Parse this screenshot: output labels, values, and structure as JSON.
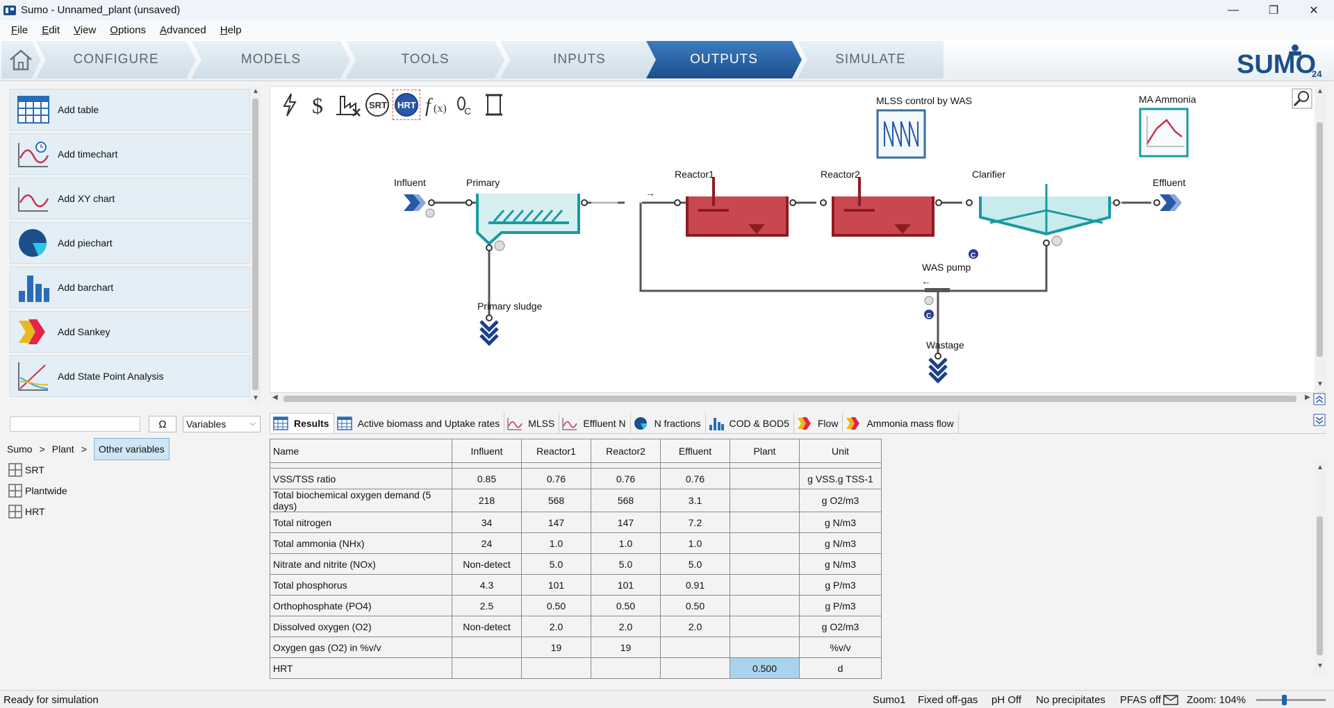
{
  "window": {
    "title": "Sumo - Unnamed_plant (unsaved)",
    "minimize": "—",
    "maximize": "❐",
    "close": "✕"
  },
  "menu": {
    "items": [
      {
        "pre": "",
        "ul": "F",
        "post": "ile"
      },
      {
        "pre": "",
        "ul": "E",
        "post": "dit"
      },
      {
        "pre": "",
        "ul": "V",
        "post": "iew"
      },
      {
        "pre": "",
        "ul": "O",
        "post": "ptions"
      },
      {
        "pre": "",
        "ul": "A",
        "post": "dvanced"
      },
      {
        "pre": "",
        "ul": "H",
        "post": "elp"
      }
    ]
  },
  "nav": {
    "tabs": [
      "CONFIGURE",
      "MODELS",
      "TOOLS",
      "INPUTS",
      "OUTPUTS",
      "SIMULATE"
    ],
    "active": "OUTPUTS",
    "logo_text": "SUMO",
    "logo_version": "24"
  },
  "tools": [
    "Add table",
    "Add timechart",
    "Add XY chart",
    "Add piechart",
    "Add barchart",
    "Add Sankey",
    "Add State Point Analysis"
  ],
  "variables": {
    "search_value": "",
    "omega": "Ω",
    "selector": "Variables",
    "breadcrumb": [
      "Sumo",
      ">",
      "Plant",
      ">"
    ],
    "breadcrumb_active": "Other variables",
    "items": [
      "SRT",
      "Plantwide",
      "HRT"
    ]
  },
  "diagram": {
    "toolbar": [
      "lightning-icon",
      "dollar-icon",
      "offgas-icon",
      "SRT",
      "HRT",
      "function-icon",
      "footprint-icon",
      "scroll-icon"
    ],
    "labels": {
      "influent": "Influent",
      "primary": "Primary",
      "reactor1": "Reactor1",
      "reactor2": "Reactor2",
      "clarifier": "Clarifier",
      "effluent": "Effluent",
      "primary_sludge": "Primary sludge",
      "was_pump": "WAS pump",
      "wastage": "Wastage",
      "mlss_control": "MLSS control by WAS",
      "ma_ammonia": "MA Ammonia",
      "controller_badge": "C"
    }
  },
  "output_tabs": [
    {
      "label": "Results",
      "icon": "table-icon",
      "active": true
    },
    {
      "label": "Active biomass and Uptake rates",
      "icon": "table-icon",
      "active": false
    },
    {
      "label": "MLSS",
      "icon": "timechart-icon",
      "active": false
    },
    {
      "label": "Effluent N",
      "icon": "timechart-icon",
      "active": false
    },
    {
      "label": "N fractions",
      "icon": "piechart-icon",
      "active": false
    },
    {
      "label": "COD & BOD5",
      "icon": "barchart-icon",
      "active": false
    },
    {
      "label": "Flow",
      "icon": "sankey-icon",
      "active": false
    },
    {
      "label": "Ammonia mass flow",
      "icon": "sankey-icon",
      "active": false
    }
  ],
  "results": {
    "columns": [
      "Name",
      "Influent",
      "Reactor1",
      "Reactor2",
      "Effluent",
      "Plant",
      "Unit"
    ],
    "rows": [
      [
        "VSS/TSS ratio",
        "0.85",
        "0.76",
        "0.76",
        "0.76",
        "",
        "g VSS.g TSS-1"
      ],
      [
        "Total biochemical oxygen demand (5 days)",
        "218",
        "568",
        "568",
        "3.1",
        "",
        "g O2/m3"
      ],
      [
        "Total nitrogen",
        "34",
        "147",
        "147",
        "7.2",
        "",
        "g N/m3"
      ],
      [
        "Total ammonia (NHx)",
        "24",
        "1.0",
        "1.0",
        "1.0",
        "",
        "g N/m3"
      ],
      [
        "Nitrate and nitrite (NOx)",
        "Non-detect",
        "5.0",
        "5.0",
        "5.0",
        "",
        "g N/m3"
      ],
      [
        "Total phosphorus",
        "4.3",
        "101",
        "101",
        "0.91",
        "",
        "g P/m3"
      ],
      [
        "Orthophosphate (PO4)",
        "2.5",
        "0.50",
        "0.50",
        "0.50",
        "",
        "g P/m3"
      ],
      [
        "Dissolved oxygen (O2)",
        "Non-detect",
        "2.0",
        "2.0",
        "2.0",
        "",
        "g O2/m3"
      ],
      [
        "Oxygen gas (O2) in %v/v",
        "",
        "19",
        "19",
        "",
        "",
        "%v/v"
      ],
      [
        "HRT",
        "",
        "",
        "",
        "",
        "0.500",
        "d"
      ]
    ],
    "highlight_color": "#a9d3ec"
  },
  "status": {
    "left": "Ready for simulation",
    "model": "Sumo1",
    "offgas": "Fixed off-gas",
    "ph": "pH Off",
    "precip": "No precipitates",
    "pfas": "PFAS off",
    "zoom": "Zoom: 104%",
    "zoom_level": 0.4
  },
  "colors": {
    "accent": "#1b4f8c",
    "reactor": "#a31d28",
    "clarifier": "#1a9aa0",
    "pipe": "#555555"
  }
}
